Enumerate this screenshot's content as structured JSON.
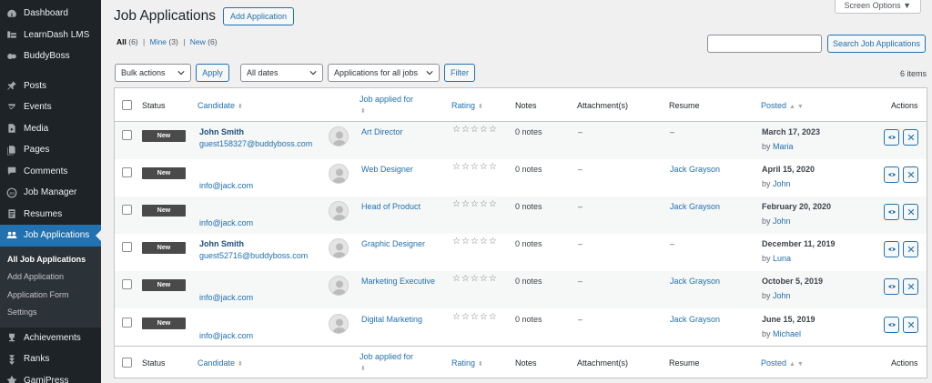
{
  "sidebar": {
    "items": [
      {
        "label": "Dashboard",
        "icon": "dashboard-icon"
      },
      {
        "label": "LearnDash LMS",
        "icon": "learndash-icon"
      },
      {
        "label": "BuddyBoss",
        "icon": "buddyboss-icon"
      },
      {
        "label": "Posts",
        "icon": "pin-icon"
      },
      {
        "label": "Events",
        "icon": "events-icon"
      },
      {
        "label": "Media",
        "icon": "media-icon"
      },
      {
        "label": "Pages",
        "icon": "pages-icon"
      },
      {
        "label": "Comments",
        "icon": "comments-icon"
      },
      {
        "label": "Job Manager",
        "icon": "job-manager-icon"
      },
      {
        "label": "Resumes",
        "icon": "resumes-icon"
      },
      {
        "label": "Job Applications",
        "icon": "job-applications-icon"
      },
      {
        "label": "Achievements",
        "icon": "achievements-icon"
      },
      {
        "label": "Ranks",
        "icon": "ranks-icon"
      },
      {
        "label": "GamiPress",
        "icon": "gamipress-icon"
      }
    ],
    "submenu": [
      "All Job Applications",
      "Add Application",
      "Application Form",
      "Settings"
    ]
  },
  "screen_options": "Screen Options ▼",
  "title": "Job Applications",
  "add_application": "Add Application",
  "filters_views": {
    "all": "All",
    "all_count": "(6)",
    "mine": "Mine",
    "mine_count": "(3)",
    "new": "New",
    "new_count": "(6)",
    "sep": "|"
  },
  "search": {
    "button": "Search Job Applications",
    "value": ""
  },
  "bulk": {
    "select": "Bulk actions",
    "apply": "Apply"
  },
  "dates_select": "All dates",
  "jobs_select": "Applications for all jobs",
  "filter_button": "Filter",
  "items_count": "6 items",
  "columns": {
    "status": "Status",
    "candidate": "Candidate",
    "job": "Job applied for",
    "rating": "Rating",
    "notes": "Notes",
    "attachments": "Attachment(s)",
    "resume": "Resume",
    "posted": "Posted",
    "actions": "Actions"
  },
  "rows": [
    {
      "status": "New",
      "name": "John Smith",
      "email": "guest158327@buddyboss.com",
      "job": "Art Director",
      "stars": "☆☆☆☆☆",
      "notes": "0 notes",
      "attachment": "–",
      "resume": "–",
      "date": "March 17, 2023",
      "by_prefix": "by",
      "by": "Maria"
    },
    {
      "status": "New",
      "name": "",
      "email": "info@jack.com",
      "job": "Web Designer",
      "stars": "☆☆☆☆☆",
      "notes": "0 notes",
      "attachment": "–",
      "resume": "Jack Grayson",
      "date": "April 15, 2020",
      "by_prefix": "by",
      "by": "John"
    },
    {
      "status": "New",
      "name": "",
      "email": "info@jack.com",
      "job": "Head of Product",
      "stars": "☆☆☆☆☆",
      "notes": "0 notes",
      "attachment": "–",
      "resume": "Jack Grayson",
      "date": "February 20, 2020",
      "by_prefix": "by",
      "by": "John"
    },
    {
      "status": "New",
      "name": "John Smith",
      "email": "guest52716@buddyboss.com",
      "job": "Graphic Designer",
      "stars": "☆☆☆☆☆",
      "notes": "0 notes",
      "attachment": "–",
      "resume": "–",
      "date": "December 11, 2019",
      "by_prefix": "by",
      "by": "Luna"
    },
    {
      "status": "New",
      "name": "",
      "email": "info@jack.com",
      "job": "Marketing Executive",
      "stars": "☆☆☆☆☆",
      "notes": "0 notes",
      "attachment": "–",
      "resume": "Jack Grayson",
      "date": "October 5, 2019",
      "by_prefix": "by",
      "by": "John"
    },
    {
      "status": "New",
      "name": "",
      "email": "info@jack.com",
      "job": "Digital Marketing",
      "stars": "☆☆☆☆☆",
      "notes": "0 notes",
      "attachment": "–",
      "resume": "Jack Grayson",
      "date": "June 15, 2019",
      "by_prefix": "by",
      "by": "Michael"
    }
  ],
  "colors": {
    "accent": "#2271b1",
    "sidebar": "#1d2327",
    "badge": "#4a4a4a"
  }
}
